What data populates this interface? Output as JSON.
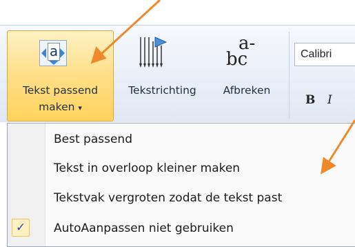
{
  "ribbon": {
    "fit_button": {
      "label_line1": "Tekst passend",
      "label_line2": "maken",
      "dropdown_glyph": "▾",
      "icon": "fit-text-icon",
      "icon_letter": "a"
    },
    "direction_button": {
      "label": "Tekstrichting",
      "icon": "text-direction-icon"
    },
    "hyphenate_button": {
      "label": "Afbreken",
      "icon": "hyphenation-icon",
      "icon_top": "a-",
      "icon_bottom": "bc"
    },
    "font_name": "Calibri",
    "bold_glyph": "B",
    "italic_glyph": "I"
  },
  "menu": {
    "items": [
      {
        "label": "Best passend",
        "checked": false
      },
      {
        "label": "Tekst in overloop kleiner maken",
        "checked": false
      },
      {
        "label": "Tekstvak vergroten zodat de tekst past",
        "checked": false
      },
      {
        "label": "AutoAanpassen niet gebruiken",
        "checked": true
      }
    ],
    "check_glyph": "✓"
  },
  "annotations": {
    "arrow_color": "#ef8a2c"
  },
  "colors": {
    "highlight": "#ffd35c",
    "ribbon_bg": "#e9eff7"
  }
}
